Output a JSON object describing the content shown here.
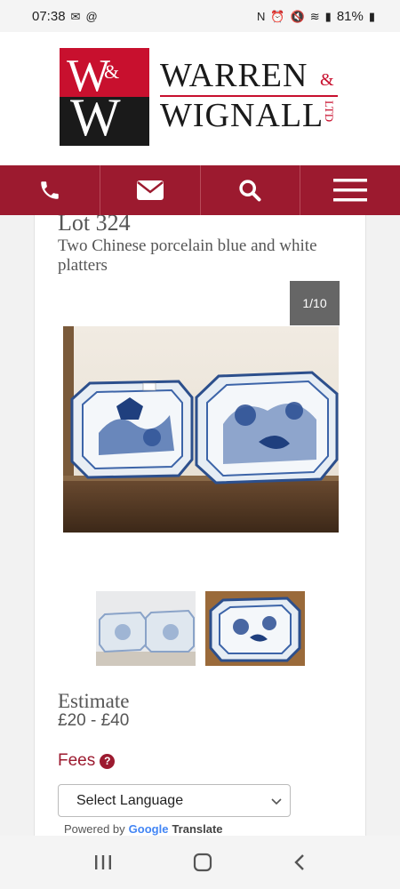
{
  "status_bar": {
    "time": "07:38",
    "battery": "81%"
  },
  "logo": {
    "mark_w1": "W",
    "mark_amp": "&",
    "mark_w2": "W",
    "line1": "WARREN",
    "amp": "&",
    "line2": "WIGNALL",
    "ltd": "LTD"
  },
  "nav": {
    "icons": [
      "phone-icon",
      "mail-icon",
      "search-icon",
      "menu-icon"
    ]
  },
  "lot": {
    "number": "Lot 324",
    "title": "Two Chinese porcelain blue and white platters",
    "image_counter": "1/10"
  },
  "estimate": {
    "label": "Estimate",
    "value": "£20 - £40"
  },
  "fees": {
    "label": "Fees"
  },
  "translate": {
    "select_label": "Select Language",
    "powered_by": "Powered by",
    "google": "Google",
    "translate": "Translate"
  },
  "colors": {
    "brand_red": "#9c1a2f",
    "logo_red": "#c8102e"
  }
}
